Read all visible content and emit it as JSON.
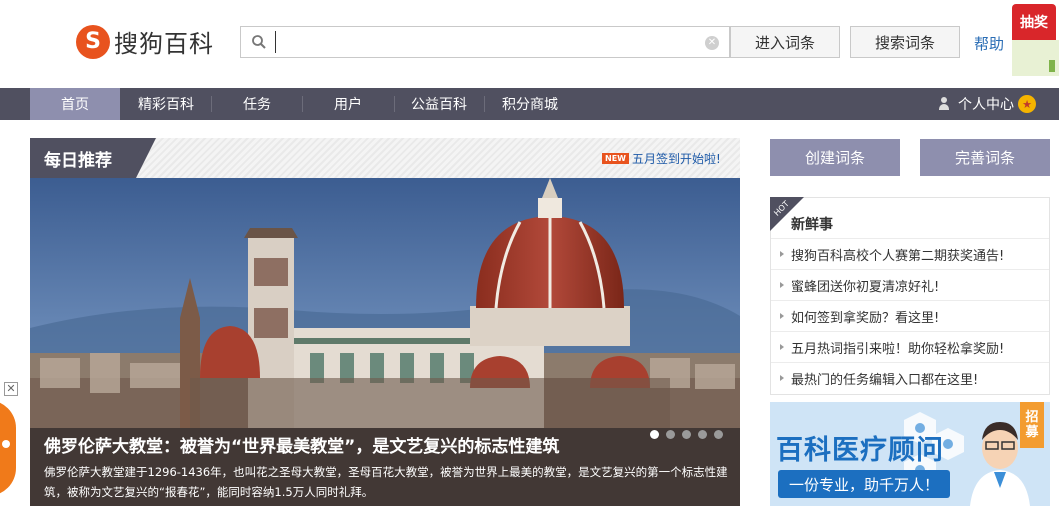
{
  "header": {
    "logo_mark": "S",
    "logo_text": "搜狗百科",
    "search_placeholder": "",
    "search_value": "",
    "enter_button": "进入词条",
    "search_button": "搜索词条",
    "help_link": "帮助",
    "lottery_tag": "抽奖"
  },
  "nav": {
    "items": [
      {
        "label": "首页",
        "active": true
      },
      {
        "label": "精彩百科",
        "active": false
      },
      {
        "label": "任务",
        "active": false
      },
      {
        "label": "用户",
        "active": false
      },
      {
        "label": "公益百科",
        "active": false
      },
      {
        "label": "积分商城",
        "active": false
      }
    ],
    "user_center": "个人中心"
  },
  "daily": {
    "title": "每日推荐",
    "new_tag": "NEW",
    "notice": "五月签到开始啦!",
    "banner": {
      "title": "佛罗伦萨大教堂：被誉为“世界最美教堂”，是文艺复兴的标志性建筑",
      "description": "佛罗伦萨大教堂建于1296-1436年，也叫花之圣母大教堂，圣母百花大教堂，被誉为世界上最美的教堂，是文艺复兴的第一个标志性建筑，被称为文艺复兴的“报春花”，能同时容纳1.5万人同时礼拜。",
      "slides": 5,
      "active_slide": 1
    }
  },
  "sidebar": {
    "create_button": "创建词条",
    "improve_button": "完善词条",
    "hot_tag": "HOT",
    "news_title": "新鲜事",
    "news": [
      "搜狗百科高校个人赛第二期获奖通告!",
      "蜜蜂团送你初夏清凉好礼!",
      "如何签到拿奖励？看这里!",
      "五月热词指引来啦！助你轻松拿奖励!",
      "最热门的任务编辑入口都在这里!"
    ],
    "ad": {
      "title": "百科医疗顾问",
      "subtitle": "一份专业，助千万人！",
      "recruit": "招募"
    }
  },
  "colors": {
    "nav_bg": "#505060",
    "accent": "#8e8fae",
    "logo": "#e8531e",
    "link": "#2a6db5"
  },
  "icons": [
    "search-icon",
    "clear-icon",
    "user-icon",
    "star-badge-icon",
    "close-icon"
  ]
}
